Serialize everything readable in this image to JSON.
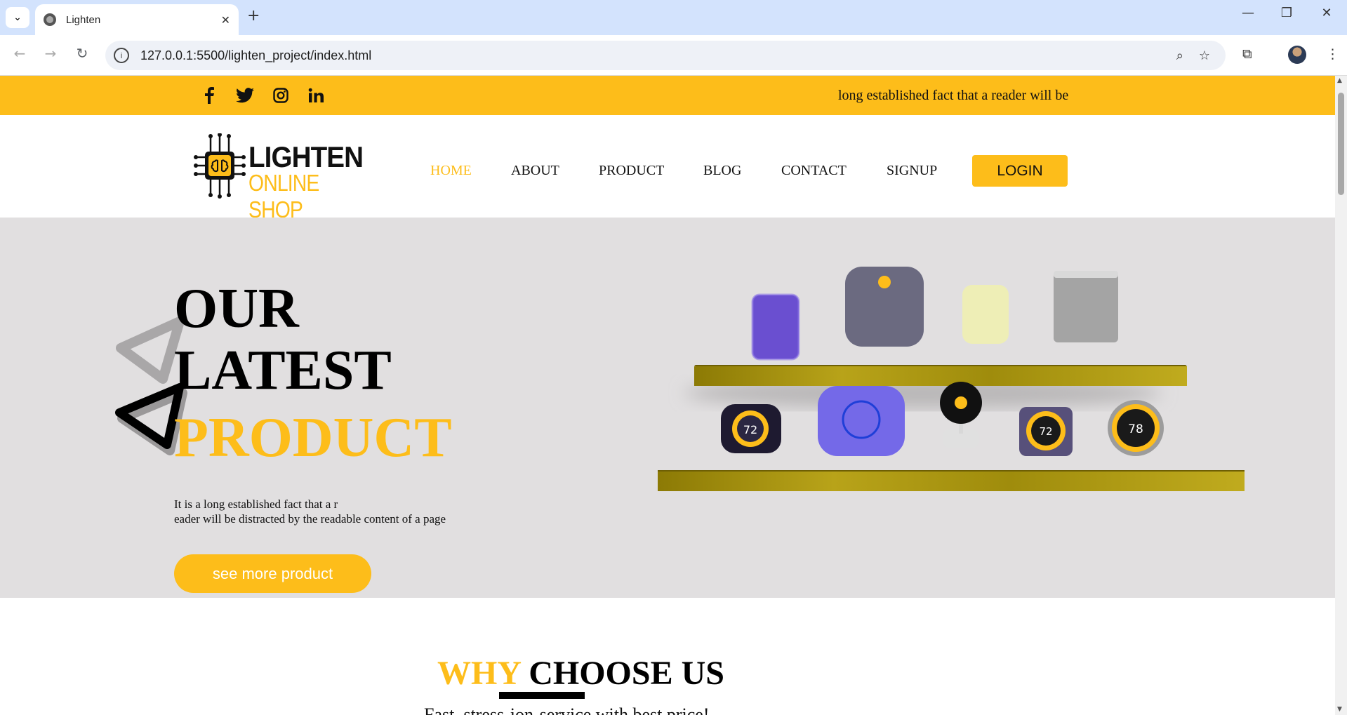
{
  "browser": {
    "tab_title": "Lighten",
    "url": "127.0.0.1:5500/lighten_project/index.html",
    "tab_close": "✕",
    "new_tab": "+",
    "back": "←",
    "forward": "→",
    "reload": "↻",
    "minimize": "—",
    "restore": "❐",
    "close": "✕"
  },
  "topbar": {
    "social": [
      "facebook-icon",
      "twitter-icon",
      "instagram-icon",
      "linkedin-icon"
    ],
    "marquee": "long established fact that a reader will be"
  },
  "header": {
    "logo_line1": "LIGHTEN",
    "logo_line2": "ONLINE SHOP",
    "nav": [
      "HOME",
      "ABOUT",
      "PRODUCT",
      "BLOG",
      "CONTACT",
      "SIGNUP"
    ],
    "active_nav": "HOME",
    "login": "LOGIN"
  },
  "hero": {
    "line1": "OUR",
    "line2": "LATEST",
    "line3": "PRODUCT",
    "desc_line1": "It is a long established fact that a r",
    "desc_line2": "eader will be distracted by the readable content of a page",
    "cta": "see more product",
    "thermostat_readings": [
      "72",
      "72",
      "78"
    ]
  },
  "why": {
    "title_yellow": "WHY",
    "title_black": "CHOOSE US",
    "subtitle": "Fast, stress-ion-service with best price!"
  },
  "colors": {
    "accent": "#fdbd1a",
    "hero_bg": "#e1dfe0",
    "tab_strip": "#d3e3fd"
  }
}
